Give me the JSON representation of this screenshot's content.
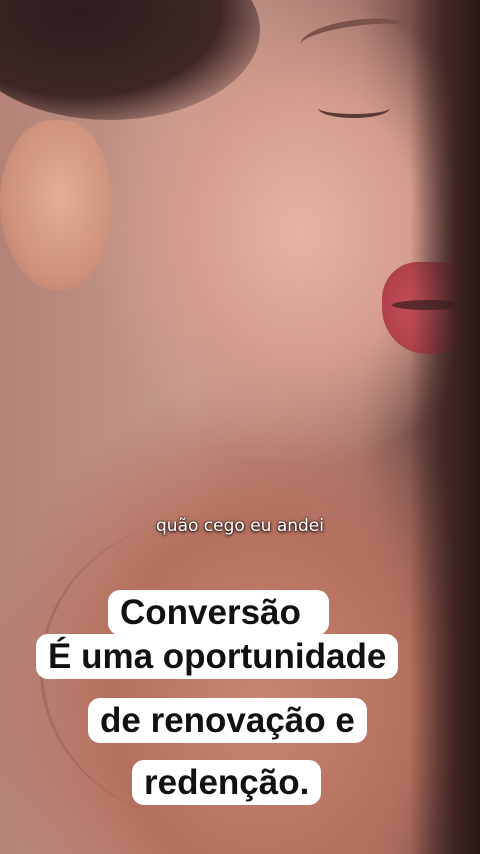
{
  "video": {
    "subtitle": "quão cego eu andei",
    "caption_lines": [
      "Conversão",
      "É uma oportunidade",
      "de renovação e",
      "redenção."
    ]
  }
}
